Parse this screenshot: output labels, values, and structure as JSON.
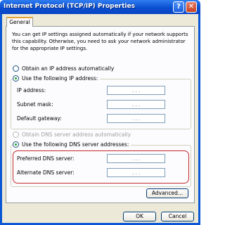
{
  "window": {
    "title": "Internet Protocol (TCP/IP) Properties",
    "help_label": "?",
    "close_label": "✕"
  },
  "tabs": [
    {
      "label": "General"
    }
  ],
  "description": "You can get IP settings assigned automatically if your network supports this capability. Otherwise, you need to ask your network administrator for the appropriate IP settings.",
  "ip": {
    "auto_label": "Obtain an IP address automatically",
    "manual_label": "Use the following IP address:",
    "selected": "manual",
    "fields": [
      {
        "label": "IP address:",
        "value": ". . ."
      },
      {
        "label": "Subnet mask:",
        "value": ". . ."
      },
      {
        "label": "Default gateway:",
        "value": ". . ."
      }
    ]
  },
  "dns": {
    "auto_label": "Obtain DNS server address automatically",
    "manual_label": "Use the following DNS server addresses:",
    "selected": "manual",
    "fields": [
      {
        "label": "Preferred DNS server:",
        "value": ". . ."
      },
      {
        "label": "Alternate DNS server:",
        "value": ". . ."
      }
    ]
  },
  "buttons": {
    "advanced": "Advanced...",
    "ok": "OK",
    "cancel": "Cancel"
  },
  "colors": {
    "titlebar": "#0a57d6",
    "highlight": "#c42b2b",
    "radio_dot": "#21a121"
  }
}
